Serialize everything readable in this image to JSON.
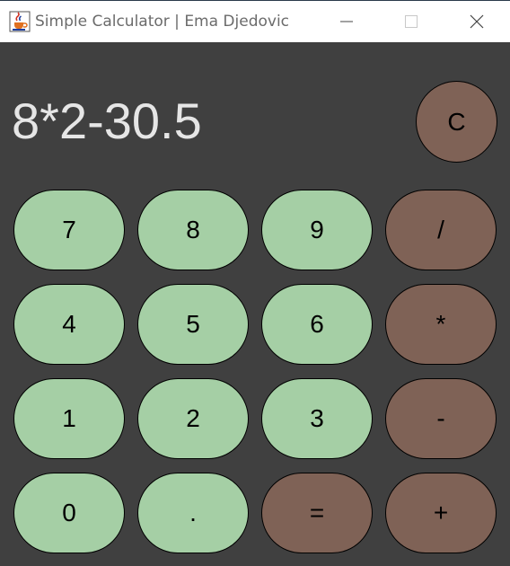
{
  "window": {
    "title": "Simple Calculator | Ema Djedovic",
    "icons": {
      "app": "java-cup-icon",
      "minimize": "minimize-icon",
      "maximize": "maximize-icon",
      "close": "close-icon"
    }
  },
  "display": {
    "value": "8*2-30.5"
  },
  "clear_button": {
    "label": "C"
  },
  "keypad": {
    "rows": [
      [
        "7",
        "8",
        "9",
        "/"
      ],
      [
        "4",
        "5",
        "6",
        "*"
      ],
      [
        "1",
        "2",
        "3",
        "-"
      ],
      [
        "0",
        ".",
        "=",
        "+"
      ]
    ]
  },
  "colors": {
    "background": "#404040",
    "number_button": "#a5cfa5",
    "operator_button": "#7f6256",
    "display_text": "#e6e6e6"
  }
}
